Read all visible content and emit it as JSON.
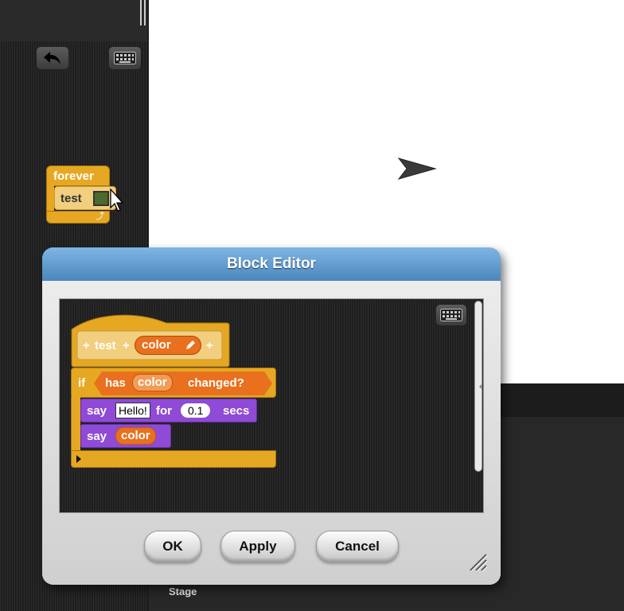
{
  "palette_blocks": {
    "forever_label": "forever",
    "test_label": "test"
  },
  "stage": {
    "label": "Stage"
  },
  "dialog": {
    "title": "Block Editor",
    "definition": {
      "plus_1": "+",
      "name": "test",
      "plus_2": "+",
      "param": "color",
      "plus_3": "+"
    },
    "script": {
      "if_label": "if",
      "has_label": "has",
      "has_param": "color",
      "changed_label": "changed?",
      "say1_label": "say",
      "say1_text": "Hello!",
      "for_label": "for",
      "say1_secs_value": "0.1",
      "secs_label": "secs",
      "say2_label": "say",
      "say2_param": "color"
    },
    "buttons": {
      "ok": "OK",
      "apply": "Apply",
      "cancel": "Cancel"
    }
  },
  "colors": {
    "control": "#e6a822",
    "operator": "#e8701e",
    "looks": "#8f4ad6",
    "dialog_header": "#5a93c8"
  },
  "icons": [
    "undo-icon",
    "keyboard-icon",
    "mouse-cursor-icon",
    "sprite-arrow-icon",
    "pencil-icon",
    "loop-arrow-icon",
    "resize-handle-icon"
  ]
}
